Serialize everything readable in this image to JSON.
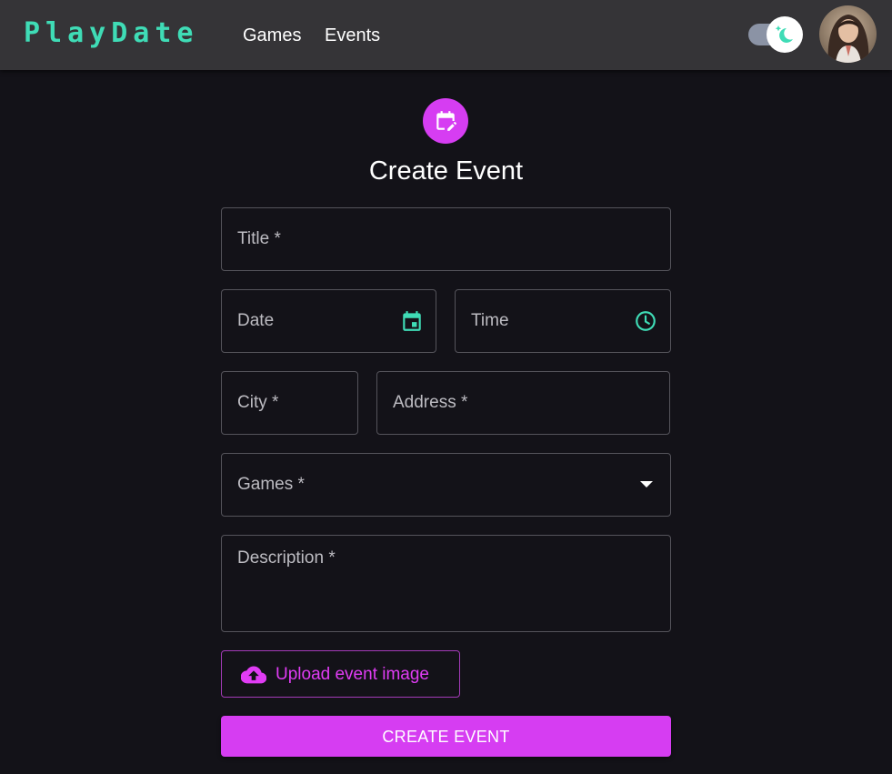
{
  "navbar": {
    "logo": "PlayDate",
    "links": [
      {
        "label": "Games"
      },
      {
        "label": "Events"
      }
    ],
    "theme_toggle_icon": "moon-sparkle-icon",
    "avatar_icon": "user-avatar"
  },
  "form": {
    "header_icon": "calendar-edit-icon",
    "title": "Create Event",
    "fields": {
      "title": {
        "label": "Title *",
        "value": ""
      },
      "date": {
        "label": "Date",
        "value": "",
        "icon": "calendar-icon"
      },
      "time": {
        "label": "Time",
        "value": "",
        "icon": "clock-icon"
      },
      "city": {
        "label": "City *",
        "value": ""
      },
      "address": {
        "label": "Address *",
        "value": ""
      },
      "games": {
        "label": "Games *",
        "value": "",
        "icon": "caret-down-icon"
      },
      "description": {
        "label": "Description *",
        "value": ""
      }
    },
    "upload_button": {
      "label": "Upload event image",
      "icon": "cloud-upload-icon"
    },
    "submit_button": {
      "label": "CREATE EVENT"
    }
  },
  "colors": {
    "background": "#131218",
    "navbar": "#353437",
    "brand_teal": "#3fdcb6",
    "accent_magenta": "#d63df2",
    "field_border": "#55545b",
    "label_text": "#bdbcc2"
  }
}
